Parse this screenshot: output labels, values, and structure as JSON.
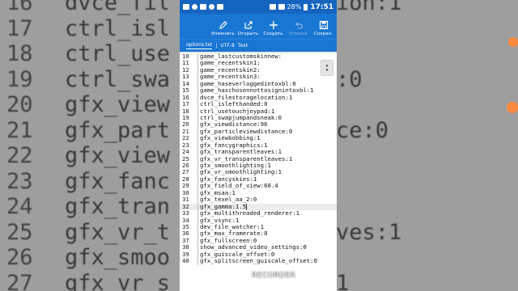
{
  "status_bar": {
    "battery": "28%",
    "time": "17:51"
  },
  "toolbar": {
    "buttons": [
      {
        "icon": "pencil-icon",
        "label": "Изменить"
      },
      {
        "icon": "open-icon",
        "label": "Открыть"
      },
      {
        "icon": "plus-icon",
        "label": "Создать"
      },
      {
        "icon": "undo-icon",
        "label": "Отмена"
      },
      {
        "icon": "save-icon",
        "label": "Сохран."
      }
    ]
  },
  "tab_bar": {
    "filename": "options.txt",
    "encoding": "UTF-8",
    "mode": "Text"
  },
  "editor": {
    "lines": [
      {
        "n": "10",
        "t": "game_lastcustomskinnew:"
      },
      {
        "n": "11",
        "t": "game_recentskin1:"
      },
      {
        "n": "12",
        "t": "game_recentskin2:"
      },
      {
        "n": "13",
        "t": "game_recentskin3:"
      },
      {
        "n": "14",
        "t": "game_haseverloggedintoxbl:0"
      },
      {
        "n": "15",
        "t": "game_haschosennottosignintoxbl:1"
      },
      {
        "n": "16",
        "t": "dvce_filestoragelocation:1"
      },
      {
        "n": "17",
        "t": "ctrl_islefthanded:0"
      },
      {
        "n": "18",
        "t": "ctrl_usetouchjoypad:1"
      },
      {
        "n": "19",
        "t": "ctrl_swapjumpandsneak:0"
      },
      {
        "n": "20",
        "t": "gfx_viewdistance:96"
      },
      {
        "n": "21",
        "t": "gfx_particleviewdistance:0"
      },
      {
        "n": "22",
        "t": "gfx_viewbobbing:1"
      },
      {
        "n": "23",
        "t": "gfx_fancygraphics:1"
      },
      {
        "n": "24",
        "t": "gfx_transparentleaves:1"
      },
      {
        "n": "25",
        "t": "gfx_vr_transparentleaves:1"
      },
      {
        "n": "26",
        "t": "gfx_smoothlighting:1"
      },
      {
        "n": "27",
        "t": "gfx_vr_smoothlighting:1"
      },
      {
        "n": "28",
        "t": "gfx_fancyskies:1"
      },
      {
        "n": "29",
        "t": "gfx_field_of_view:60.4"
      },
      {
        "n": "30",
        "t": "gfx_msaa:1"
      },
      {
        "n": "31",
        "t": "gfx_texel_aa_2:0"
      },
      {
        "n": "32",
        "t": "gfx_gamma:1.5"
      },
      {
        "n": "33",
        "t": "gfx_multithreaded_renderer:1"
      },
      {
        "n": "34",
        "t": "gfx_vsync:1"
      },
      {
        "n": "35",
        "t": "dev_file_watcher:1"
      },
      {
        "n": "36",
        "t": "gfx_max_framerate:0"
      },
      {
        "n": "37",
        "t": "gfx_fullscreen:0"
      },
      {
        "n": "38",
        "t": "show_advanced_video_settings:0"
      },
      {
        "n": "39",
        "t": "gfx_guiscale_offset:0"
      },
      {
        "n": "40",
        "t": "gfx_splitscreen_guiscale_offset:0"
      }
    ],
    "current_line": "32"
  },
  "background_left": [
    {
      "n": "16",
      "t": "dvce_fil"
    },
    {
      "n": "17",
      "t": "ctrl_isl"
    },
    {
      "n": "18",
      "t": "ctrl_use"
    },
    {
      "n": "19",
      "t": "ctrl_swa"
    },
    {
      "n": "20",
      "t": "gfx_view"
    },
    {
      "n": "21",
      "t": "gfx_part"
    },
    {
      "n": "22",
      "t": "gfx_view"
    },
    {
      "n": "23",
      "t": "gfx_fanc"
    },
    {
      "n": "24",
      "t": "gfx_tran"
    },
    {
      "n": "25",
      "t": "gfx_vr_t"
    },
    {
      "n": "26",
      "t": "gfx_smoo"
    },
    {
      "n": "27",
      "t": "gfx_vr_s"
    }
  ],
  "background_right": [
    "ion:1",
    "",
    "",
    ":0",
    "",
    "ce:0",
    "",
    "",
    "",
    "ves:1",
    "",
    "1"
  ],
  "watermark": "RECORDER",
  "colors": {
    "status_bar": "#1565c0",
    "toolbar": "#1976d2",
    "accent_orange": "#ff8a3d"
  }
}
